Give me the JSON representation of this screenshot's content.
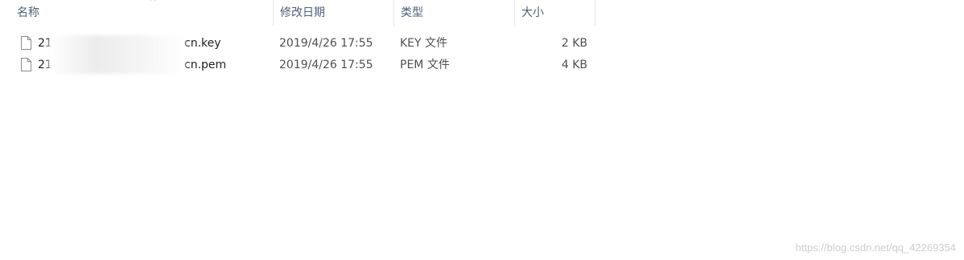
{
  "columns": {
    "name": "名称",
    "modified": "修改日期",
    "type": "类型",
    "size": "大小"
  },
  "sort_indicator": "^",
  "files": [
    {
      "name_prefix": "21",
      "name_suffix": "cn.key",
      "modified": "2019/4/26 17:55",
      "type": "KEY 文件",
      "size": "2 KB",
      "icon": "file-icon"
    },
    {
      "name_prefix": "21",
      "name_suffix": "cn.pem",
      "modified": "2019/4/26 17:55",
      "type": "PEM 文件",
      "size": "4 KB",
      "icon": "file-icon"
    }
  ],
  "watermark": "https://blog.csdn.net/qq_42269354"
}
